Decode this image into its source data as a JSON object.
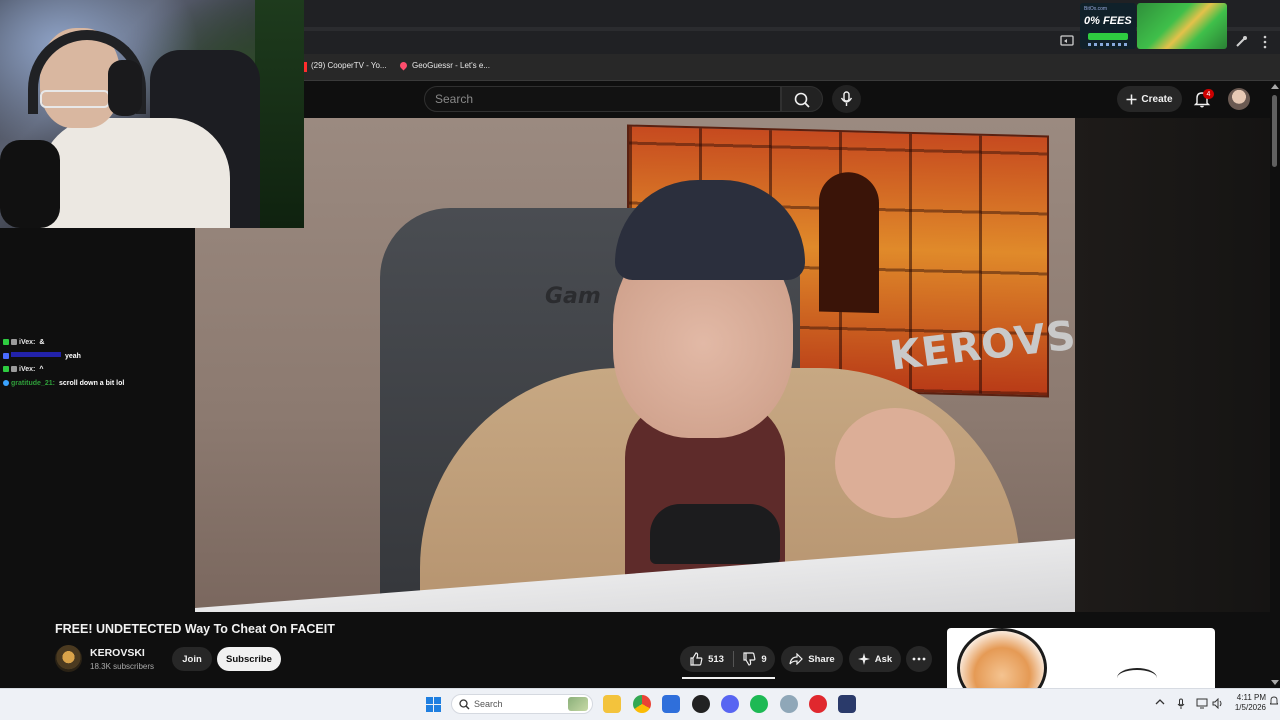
{
  "browser": {
    "ad_small": "BitOx.com",
    "ad_big": "0% FEES",
    "bookmarks": [
      {
        "label": "(29) CooperTV - Yo..."
      },
      {
        "label": "GeoGuessr - Let's e..."
      }
    ]
  },
  "youtube": {
    "search_placeholder": "Search",
    "create_label": "Create",
    "notification_count": "4"
  },
  "player": {
    "poster_text": "KEROVSKI",
    "chair_text": "Gam"
  },
  "chat": [
    {
      "user": "iVex:",
      "message": "&",
      "user_color": "#e8e8e8",
      "badges": [
        "#2ecc40",
        "#9b9b9b"
      ]
    },
    {
      "user": "",
      "message": "yeah",
      "user_color": "#2c2cff",
      "badges": [
        "#4a6cff"
      ]
    },
    {
      "user": "iVex:",
      "message": "^",
      "user_color": "#e8e8e8",
      "badges": [
        "#2ecc40",
        "#9b9b9b"
      ]
    },
    {
      "user": "gratitude_21:",
      "message": "scroll down a bit lol",
      "user_color": "#2f9e3a",
      "badges": [
        "#3aa3ff"
      ]
    }
  ],
  "video": {
    "title": "FREE! UNDETECTED Way To Cheat On FACEIT",
    "channel_name": "KEROVSKI",
    "subscribers": "18.3K subscribers",
    "join_label": "Join",
    "subscribe_label": "Subscribe",
    "likes": "513",
    "dislikes": "9",
    "share_label": "Share",
    "ask_label": "Ask"
  },
  "taskbar": {
    "search_placeholder": "Search",
    "time": "4:11 PM",
    "date": "1/5/2026",
    "accent": "#1f7fe0"
  },
  "colors": {
    "yt_bg": "#0f0f0f",
    "button_bg": "#272727",
    "notification_red": "#cc0000"
  }
}
